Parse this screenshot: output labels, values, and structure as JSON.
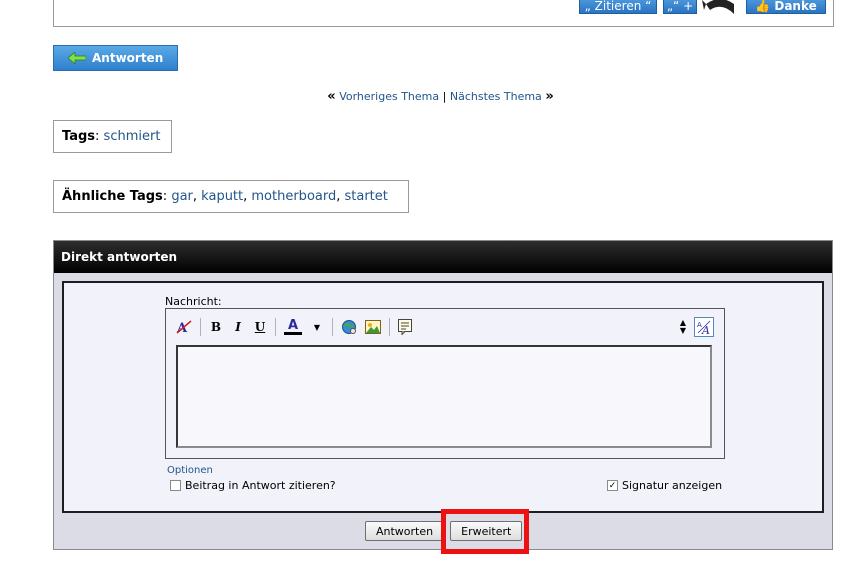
{
  "post_buttons": {
    "quote": "„ Zitieren “",
    "multi_quote": "„“ +",
    "thanks": "Danke"
  },
  "reply_button": {
    "label": "Antworten"
  },
  "thread_nav": {
    "prev": "Vorheriges Thema",
    "separator": "|",
    "next": "Nächstes Thema",
    "left_quote": "«",
    "right_quote": "»"
  },
  "tags": {
    "label": "Tags",
    "colon": ":",
    "items": [
      "schmiert"
    ]
  },
  "similar_tags": {
    "label": "Ähnliche Tags",
    "colon": ":",
    "items": [
      "gar",
      "kaputt",
      "motherboard",
      "startet"
    ]
  },
  "quick_reply": {
    "title": "Direkt antworten",
    "message_label": "Nachricht:",
    "options_label": "Optionen",
    "quote_post_label": "Beitrag in Antwort zitieren?",
    "quote_post_checked": false,
    "signature_label": "Signatur anzeigen",
    "signature_checked": true,
    "submit_label": "Antworten",
    "advanced_label": "Erweitert"
  },
  "toolbar": {
    "bold": "B",
    "italic": "I",
    "underline": "U",
    "font_color": "A"
  },
  "colors": {
    "highlight": "#ee1111",
    "link": "#22558a",
    "header_bg": "#000000",
    "button_blue": "#2f7fcf"
  }
}
